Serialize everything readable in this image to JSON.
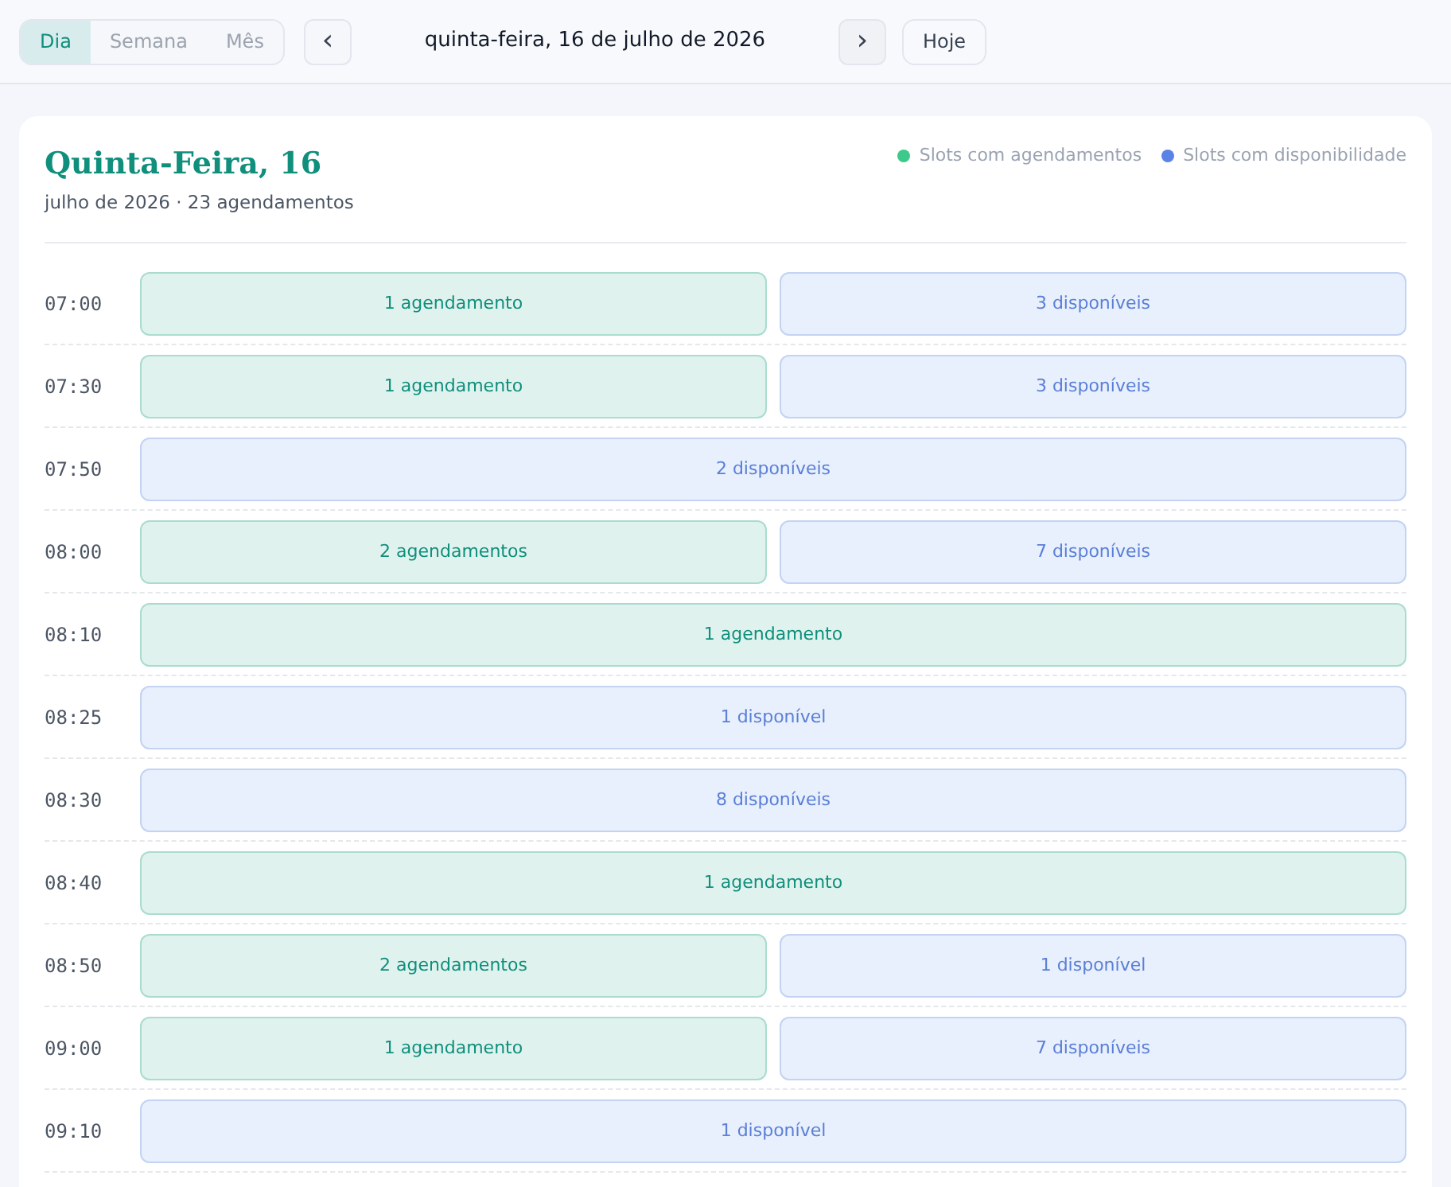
{
  "view_tabs": [
    {
      "label": "Dia",
      "selected": true
    },
    {
      "label": "Semana",
      "selected": false
    },
    {
      "label": "Mês",
      "selected": false
    }
  ],
  "prev_button": "‹",
  "current_date": "quinta-feira, 16 de julho de 2026",
  "next_button": "›",
  "today_button": "Hoje",
  "day_title": "Quinta-Feira, 16",
  "day_subtitle": "julho de 2026 · 23 agendamentos",
  "legend": [
    {
      "label": "Slots com agendamentos",
      "color": "#3cc98a"
    },
    {
      "label": "Slots com disponibilidade",
      "color": "#5b82e6"
    }
  ],
  "slots": [
    {
      "time": "07:00",
      "blocks": [
        {
          "kind": "booked",
          "label": "1 agendamento"
        },
        {
          "kind": "available",
          "label": "3 disponíveis"
        }
      ]
    },
    {
      "time": "07:30",
      "blocks": [
        {
          "kind": "booked",
          "label": "1 agendamento"
        },
        {
          "kind": "available",
          "label": "3 disponíveis"
        }
      ]
    },
    {
      "time": "07:50",
      "blocks": [
        {
          "kind": "available",
          "label": "2 disponíveis"
        }
      ]
    },
    {
      "time": "08:00",
      "blocks": [
        {
          "kind": "booked",
          "label": "2 agendamentos"
        },
        {
          "kind": "available",
          "label": "7 disponíveis"
        }
      ]
    },
    {
      "time": "08:10",
      "blocks": [
        {
          "kind": "booked",
          "label": "1 agendamento"
        }
      ]
    },
    {
      "time": "08:25",
      "blocks": [
        {
          "kind": "available",
          "label": "1 disponível"
        }
      ]
    },
    {
      "time": "08:30",
      "blocks": [
        {
          "kind": "available",
          "label": "8 disponíveis"
        }
      ]
    },
    {
      "time": "08:40",
      "blocks": [
        {
          "kind": "booked",
          "label": "1 agendamento"
        }
      ]
    },
    {
      "time": "08:50",
      "blocks": [
        {
          "kind": "booked",
          "label": "2 agendamentos"
        },
        {
          "kind": "available",
          "label": "1 disponível"
        }
      ]
    },
    {
      "time": "09:00",
      "blocks": [
        {
          "kind": "booked",
          "label": "1 agendamento"
        },
        {
          "kind": "available",
          "label": "7 disponíveis"
        }
      ]
    },
    {
      "time": "09:10",
      "blocks": [
        {
          "kind": "available",
          "label": "1 disponível"
        }
      ]
    }
  ]
}
